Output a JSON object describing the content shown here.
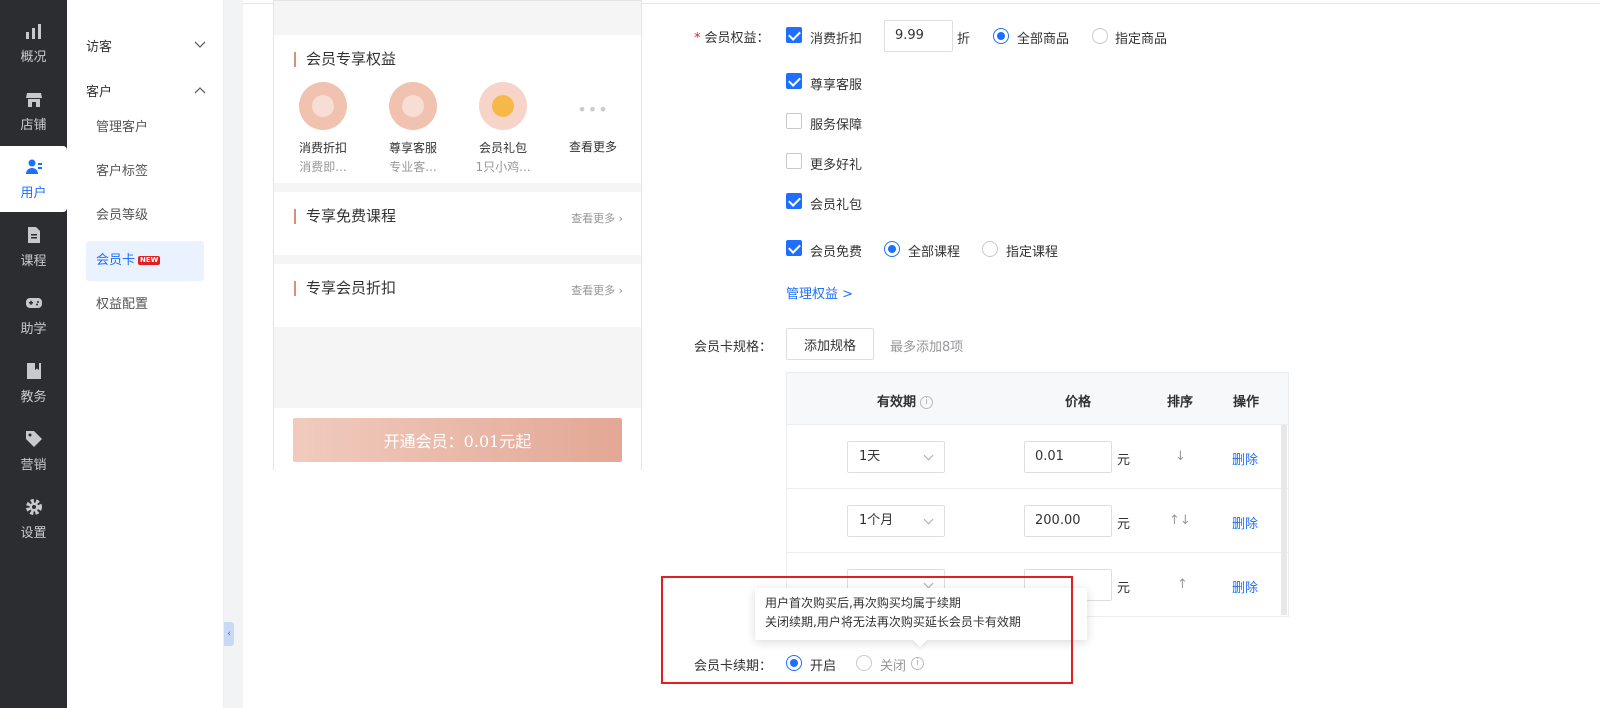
{
  "nav": {
    "items": [
      {
        "label": "概况",
        "icon": "chart-icon"
      },
      {
        "label": "店铺",
        "icon": "store-icon"
      },
      {
        "label": "用户",
        "icon": "users-icon"
      },
      {
        "label": "课程",
        "icon": "document-icon"
      },
      {
        "label": "助学",
        "icon": "gamepad-icon"
      },
      {
        "label": "教务",
        "icon": "book-icon"
      },
      {
        "label": "营销",
        "icon": "tag-icon"
      },
      {
        "label": "设置",
        "icon": "gear-icon"
      }
    ],
    "active": "用户"
  },
  "subnav": {
    "visitor": "访客",
    "customer": "客户",
    "items": [
      "管理客户",
      "客户标签",
      "会员等级",
      "会员卡",
      "权益配置"
    ],
    "active": "会员卡",
    "new_badge": "NEW"
  },
  "preview": {
    "benefits_title": "会员专享权益",
    "benefits": [
      {
        "name": "消费折扣",
        "desc": "消费即..."
      },
      {
        "name": "尊享客服",
        "desc": "专业客..."
      },
      {
        "name": "会员礼包",
        "desc": "1只小鸡..."
      }
    ],
    "see_more": "查看更多",
    "free_course_title": "专享免费课程",
    "discount_title": "专享会员折扣",
    "more_link": "查看更多",
    "open_button": "开通会员：0.01元起"
  },
  "form": {
    "benefits_label": "会员权益：",
    "discount_label": "消费折扣",
    "discount_value": "9.99",
    "discount_unit": "折",
    "all_goods": "全部商品",
    "specific_goods": "指定商品",
    "vip_service": "尊享客服",
    "service_guarantee": "服务保障",
    "more_gifts": "更多好礼",
    "gift_pack": "会员礼包",
    "free_member": "会员免费",
    "all_courses": "全部课程",
    "specific_courses": "指定课程",
    "manage_link": "管理权益 >",
    "spec_label": "会员卡规格：",
    "add_spec": "添加规格",
    "spec_hint": "最多添加8项",
    "table": {
      "headers": [
        "有效期",
        "价格",
        "排序",
        "操作"
      ],
      "rows": [
        {
          "period": "1天",
          "price": "0.01",
          "unit": "元",
          "sort": "↓",
          "action": "删除"
        },
        {
          "period": "1个月",
          "price": "200.00",
          "unit": "元",
          "sort": "↑↓",
          "action": "删除"
        },
        {
          "period": "",
          "price": "",
          "unit": "元",
          "sort": "↑",
          "action": "删除"
        }
      ]
    },
    "tooltip_line1": "用户首次购买后,再次购买均属于续期",
    "tooltip_line2": "关闭续期,用户将无法再次购买延长会员卡有效期",
    "renew_label": "会员卡续期：",
    "renew_on": "开启",
    "renew_off": "关闭"
  },
  "colors": {
    "accent": "#1e6fff",
    "nav_bg": "#2b2d31",
    "highlight_box": "#e02020",
    "peach": "#e3a795"
  }
}
